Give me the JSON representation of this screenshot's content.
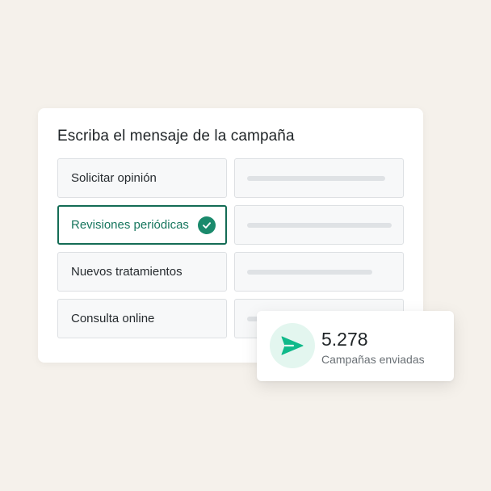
{
  "campaign": {
    "title": "Escriba el mensaje de la campaña",
    "options": [
      {
        "label": "Solicitar opinión",
        "selected": false
      },
      {
        "label": "Revisiones periódicas",
        "selected": true
      },
      {
        "label": "Nuevos tratamientos",
        "selected": false
      },
      {
        "label": "Consulta online",
        "selected": false
      }
    ]
  },
  "stats": {
    "value": "5.278",
    "label": "Campañas enviadas",
    "icon": "send-icon"
  },
  "colors": {
    "accent": "#146c55",
    "check": "#1a8a6c",
    "send_icon": "#10b98a",
    "send_icon_bg": "#e3f6ef",
    "background": "#f5f1eb"
  }
}
